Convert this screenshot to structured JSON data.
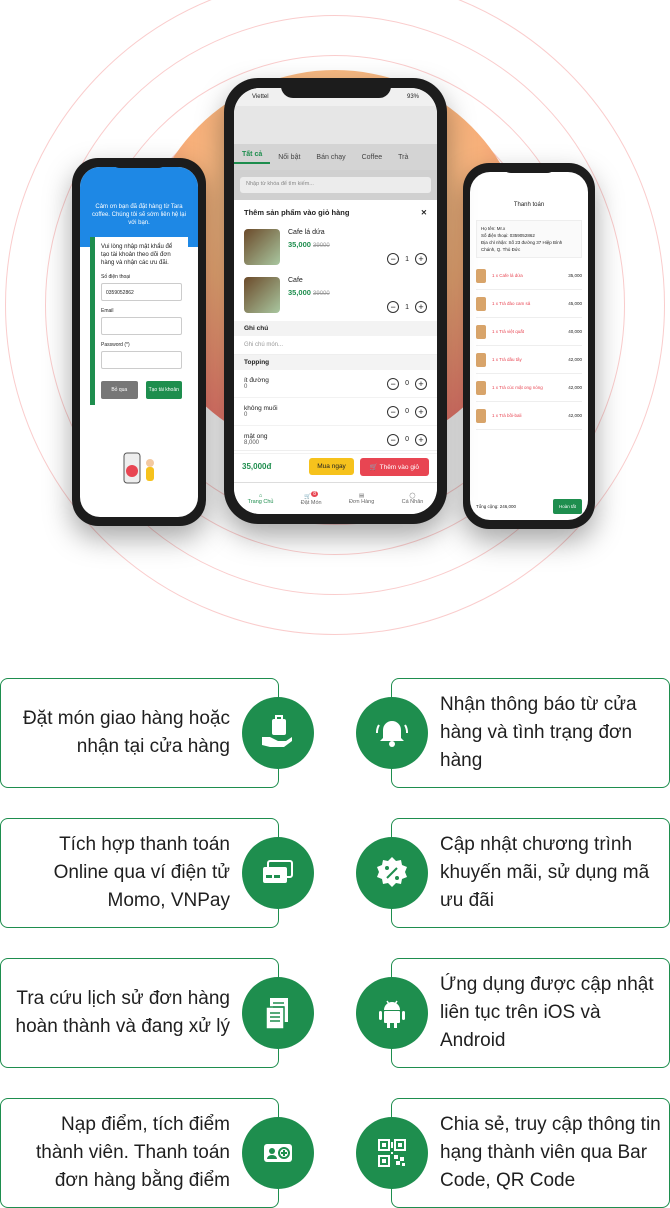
{
  "left_phone": {
    "welcome": "Cảm ơn bạn đã đặt hàng từ Tara coffee. Chúng tôi sẽ sớm liên hệ lại với bạn.",
    "prompt": "Vui lòng nhập mật khẩu để tạo tài khoản theo dõi đơn hàng và nhận các ưu đãi.",
    "phone_label": "Số điện thoại",
    "phone_value": "0359052862",
    "email_label": "Email",
    "password_label": "Password (*)",
    "skip_button": "Bỏ qua",
    "create_button": "Tạo tài khoản"
  },
  "center_phone": {
    "carrier": "Viettel",
    "battery": "93%",
    "tabs": [
      "Tất cả",
      "Nổi bật",
      "Bán chạy",
      "Coffee",
      "Trà"
    ],
    "search_placeholder": "Nhập từ khóa để tìm kiếm...",
    "sheet_title": "Thêm sản phẩm vào giỏ hàng",
    "products": [
      {
        "name": "Cafe lá dứa",
        "price": "35,000",
        "old_price": "39000",
        "qty": "1"
      },
      {
        "name": "Cafe",
        "price": "35,000",
        "old_price": "39000",
        "qty": "1"
      }
    ],
    "note_label": "Ghi chú",
    "note_placeholder": "Ghi chú món...",
    "topping_label": "Topping",
    "toppings": [
      {
        "name": "ít đường",
        "price": "0",
        "qty": "0"
      },
      {
        "name": "không muối",
        "price": "0",
        "qty": "0"
      },
      {
        "name": "mật ong",
        "price": "8,000",
        "qty": "0"
      }
    ],
    "total": "35,000đ",
    "buy_now": "Mua ngay",
    "add_to_cart": "Thêm vào giỏ",
    "nav": [
      "Trang Chủ",
      "Đặt Món",
      "Đơn Hàng",
      "Cá Nhân"
    ],
    "cart_badge": "8"
  },
  "right_phone": {
    "title": "Thanh toán",
    "info": [
      {
        "label": "Họ tên",
        "value": "Mr.x"
      },
      {
        "label": "Số điện thoại",
        "value": "0359052862"
      },
      {
        "label": "Địa chỉ nhận",
        "value": "Số 23 đường 37 Hiệp Bình Chánh, Q. Thủ Đức"
      }
    ],
    "items": [
      {
        "name": "1 x Cafe lá dứa",
        "price": "35,000"
      },
      {
        "name": "1 x Trà đào cam sả",
        "price": "45,000"
      },
      {
        "name": "1 x Trà việt quất",
        "price": "40,000"
      },
      {
        "name": "1 x Trà dâu tây",
        "price": "42,000"
      },
      {
        "name": "1 x Trà cúc mật ong nóng",
        "price": "42,000"
      },
      {
        "name": "1 x Trà bồi-bali",
        "price": "42,000"
      }
    ],
    "total_label": "Tổng cộng: 246,000",
    "done_button": "Hoàn tất"
  },
  "features": [
    {
      "text": "Đặt món giao hàng hoặc nhận tại cửa hàng",
      "icon": "delivery-hand-icon"
    },
    {
      "text": "Nhận thông báo từ cửa hàng và tình trạng đơn hàng",
      "icon": "bell-icon"
    },
    {
      "text": "Tích hợp thanh toán Online qua ví điện tử Momo, VNPay",
      "icon": "payment-cards-icon"
    },
    {
      "text": "Cập nhật chương trình khuyến mãi, sử dụng mã ưu đãi",
      "icon": "discount-badge-icon"
    },
    {
      "text": "Tra cứu lịch sử đơn hàng hoàn thành và đang xử lý",
      "icon": "order-history-icon"
    },
    {
      "text": "Ứng dụng được cập nhật liên tục trên iOS và Android",
      "icon": "android-icon"
    },
    {
      "text": "Nạp điểm, tích điểm thành viên. Thanh toán đơn hàng bằng điểm",
      "icon": "member-points-icon"
    },
    {
      "text": "Chia sẻ, truy cập thông tin hạng thành viên qua Bar Code, QR Code",
      "icon": "qr-code-icon"
    }
  ],
  "colors": {
    "brand_green": "#1e8e4e",
    "accent_red": "#e84552",
    "accent_yellow": "#f6c21c"
  }
}
